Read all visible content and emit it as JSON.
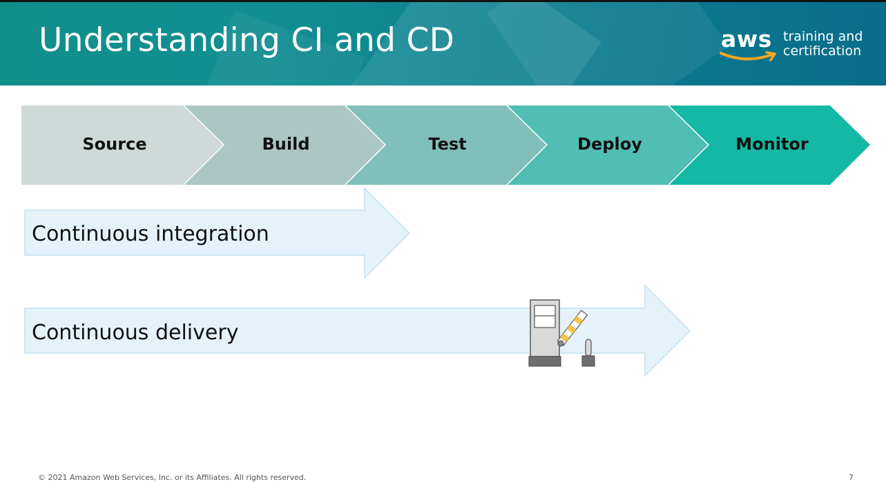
{
  "header": {
    "title": "Understanding CI and CD",
    "logo_wordmark": "aws",
    "logo_text": "training and certification"
  },
  "stages": [
    {
      "label": "Source",
      "color": "#cfd9d7"
    },
    {
      "label": "Build",
      "color": "#abc7c4"
    },
    {
      "label": "Test",
      "color": "#81c0b9"
    },
    {
      "label": "Deploy",
      "color": "#50beb4"
    },
    {
      "label": "Monitor",
      "color": "#15b8a5"
    }
  ],
  "arrows": {
    "integration": "Continuous integration",
    "delivery": "Continuous delivery"
  },
  "footer": {
    "copyright": "© 2021 Amazon Web Services, Inc. or its Affiliates. All rights reserved.",
    "page_number": "7"
  },
  "colors": {
    "arrow_fill": "#e5f2fa",
    "arrow_border": "#c3e0f0",
    "accent_orange": "#f5a623"
  }
}
